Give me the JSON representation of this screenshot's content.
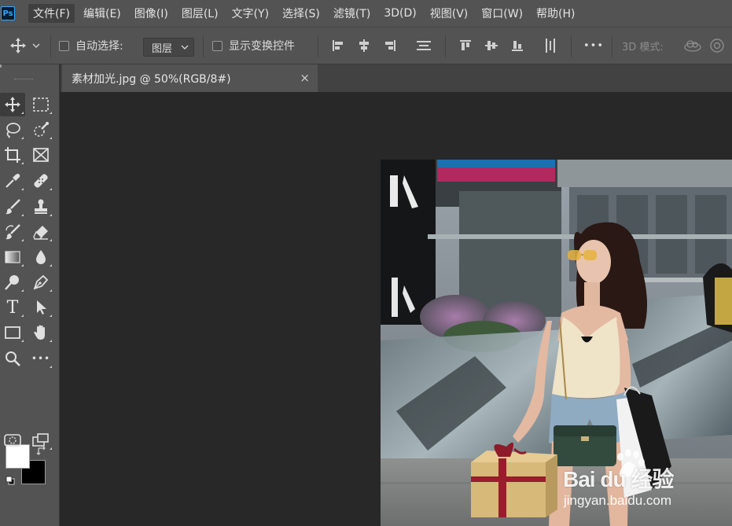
{
  "app": {
    "logo_text": "Ps",
    "accent": "#31a8ff"
  },
  "menu": [
    {
      "label": "文件(F)"
    },
    {
      "label": "编辑(E)"
    },
    {
      "label": "图像(I)"
    },
    {
      "label": "图层(L)"
    },
    {
      "label": "文字(Y)"
    },
    {
      "label": "选择(S)"
    },
    {
      "label": "滤镜(T)"
    },
    {
      "label": "3D(D)"
    },
    {
      "label": "视图(V)"
    },
    {
      "label": "窗口(W)"
    },
    {
      "label": "帮助(H)"
    }
  ],
  "options": {
    "auto_select_label": "自动选择:",
    "auto_select_checked": false,
    "auto_select_target": "图层",
    "show_transform_label": "显示变换控件",
    "show_transform_checked": false,
    "more_label": "•••",
    "mode_3d_label": "3D 模式:"
  },
  "document": {
    "tab_title": "素材加光.jpg @ 50%(RGB/8#)",
    "close_glyph": "×"
  },
  "tools": [
    {
      "name": "move-tool",
      "icon": "move-icon"
    },
    {
      "name": "marquee-tool",
      "icon": "rect-marquee-icon"
    },
    {
      "name": "lasso-tool",
      "icon": "lasso-icon"
    },
    {
      "name": "quick-select-tool",
      "icon": "quick-select-icon"
    },
    {
      "name": "crop-tool",
      "icon": "crop-icon"
    },
    {
      "name": "frame-tool",
      "icon": "frame-icon"
    },
    {
      "name": "eyedropper-tool",
      "icon": "eyedropper-icon"
    },
    {
      "name": "healing-tool",
      "icon": "bandage-icon"
    },
    {
      "name": "brush-tool",
      "icon": "brush-icon"
    },
    {
      "name": "stamp-tool",
      "icon": "stamp-icon"
    },
    {
      "name": "history-brush-tool",
      "icon": "history-brush-icon"
    },
    {
      "name": "eraser-tool",
      "icon": "eraser-icon"
    },
    {
      "name": "gradient-tool",
      "icon": "gradient-icon"
    },
    {
      "name": "blur-tool",
      "icon": "drop-icon"
    },
    {
      "name": "dodge-tool",
      "icon": "dodge-icon"
    },
    {
      "name": "pen-tool",
      "icon": "pen-icon"
    },
    {
      "name": "type-tool",
      "icon": "type-icon"
    },
    {
      "name": "path-select-tool",
      "icon": "arrow-icon"
    },
    {
      "name": "shape-tool",
      "icon": "rectangle-icon"
    },
    {
      "name": "hand-tool",
      "icon": "hand-icon"
    },
    {
      "name": "zoom-tool",
      "icon": "zoom-icon"
    },
    {
      "name": "more-tools",
      "icon": "ellipsis-icon"
    }
  ],
  "colors": {
    "foreground": "#ffffff",
    "background": "#000000"
  },
  "type_tool_glyph": "T",
  "more_tools_glyph": "•••",
  "watermark": {
    "logo": "Bai du 经验",
    "url": "jingyan.baidu.com"
  }
}
